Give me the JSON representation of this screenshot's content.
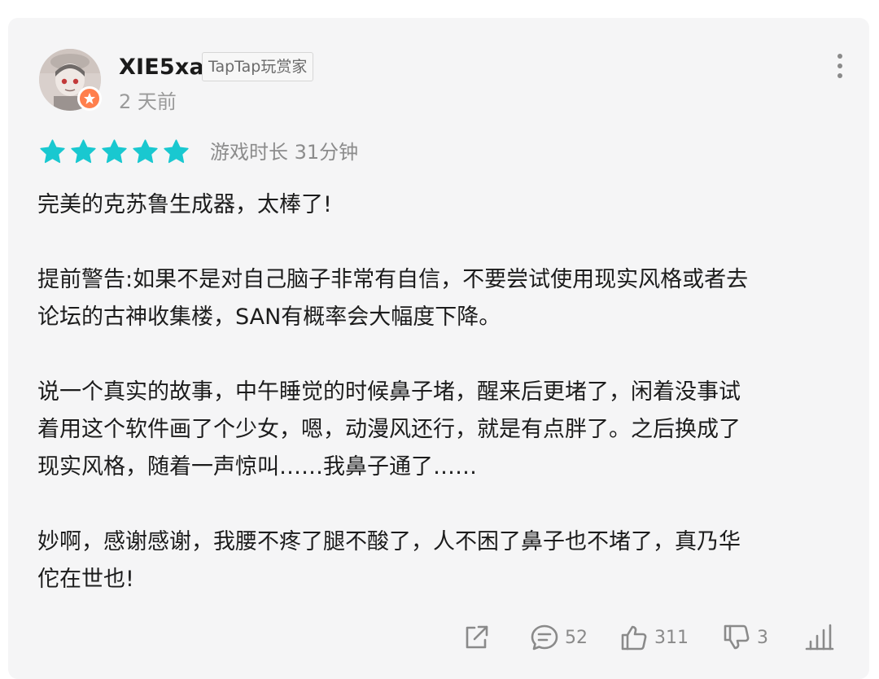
{
  "review": {
    "username": "XIE5xa",
    "tag": "TapTap玩赏家",
    "time": "2 天前",
    "rating": 5,
    "playtime": "游戏时长 31分钟",
    "paragraphs": [
      [
        "完美的克苏鲁生成器，太棒了!"
      ],
      [
        "提前警告:如果不是对自己脑子非常有自信，不要尝试使用现实风格或者去",
        "论坛的古神收集楼，SAN有概率会大幅度下降。"
      ],
      [
        "说一个真实的故事，中午睡觉的时候鼻子堵，醒来后更堵了，闲着没事试",
        "着用这个软件画了个少女，嗯，动漫风还行，就是有点胖了。之后换成了",
        "现实风格，随着一声惊叫……我鼻子通了……"
      ],
      [
        "妙啊，感谢感谢，我腰不疼了腿不酸了，人不困了鼻子也不堵了，真乃华",
        "佗在世也!"
      ]
    ]
  },
  "actions": {
    "share_icon": "share-icon",
    "comment_icon": "comment-icon",
    "comments": "52",
    "like_icon": "thumbs-up-icon",
    "likes": "311",
    "dislike_icon": "thumbs-down-icon",
    "dislikes": "3",
    "stats_icon": "bar-chart-icon"
  },
  "colors": {
    "star": "#19c8d0",
    "badge": "#ff7f4d",
    "card_bg": "#f5f5f6",
    "icon": "#8a8a8a"
  }
}
